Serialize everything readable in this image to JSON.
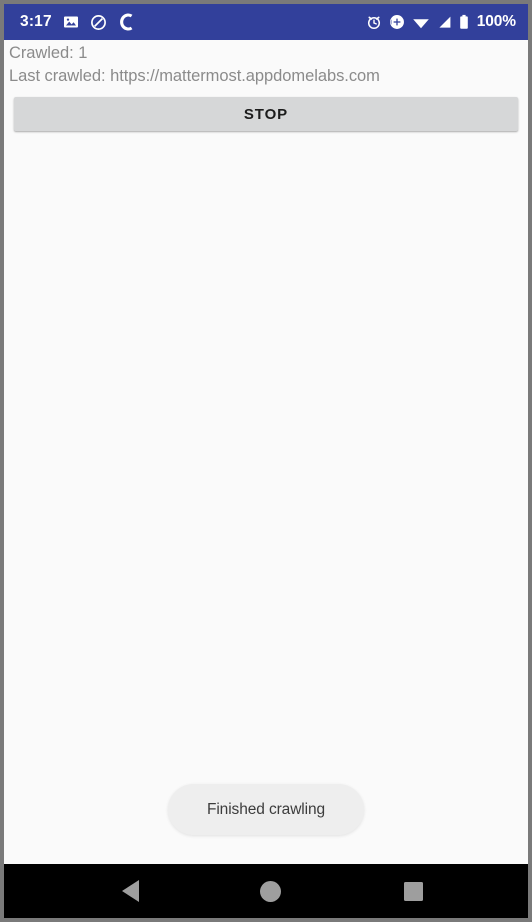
{
  "status_bar": {
    "time": "3:17",
    "battery_percent": "100%",
    "background_color": "#32409b",
    "left_icons": [
      "image-icon",
      "do-not-disturb-icon",
      "letter-c-icon"
    ],
    "right_icons": [
      "alarm-icon",
      "location-icon",
      "wifi-icon",
      "cellular-signal-icon",
      "battery-icon"
    ]
  },
  "app": {
    "crawled_label": "Crawled: 1",
    "last_crawled_label": "Last crawled: https://mattermost.appdomelabs.com",
    "stop_button_label": "STOP",
    "background_color": "#fafafa",
    "text_color": "#8b8b8b"
  },
  "toast": {
    "message": "Finished crawling",
    "background_color": "#eeeeee",
    "text_color": "#3c3c3c"
  },
  "navigation_bar": {
    "background_color": "#000000",
    "icon_color": "#9e9e9e",
    "buttons": [
      {
        "name": "back",
        "icon": "triangle-back-icon"
      },
      {
        "name": "home",
        "icon": "circle-home-icon"
      },
      {
        "name": "recents",
        "icon": "square-recents-icon"
      }
    ]
  }
}
